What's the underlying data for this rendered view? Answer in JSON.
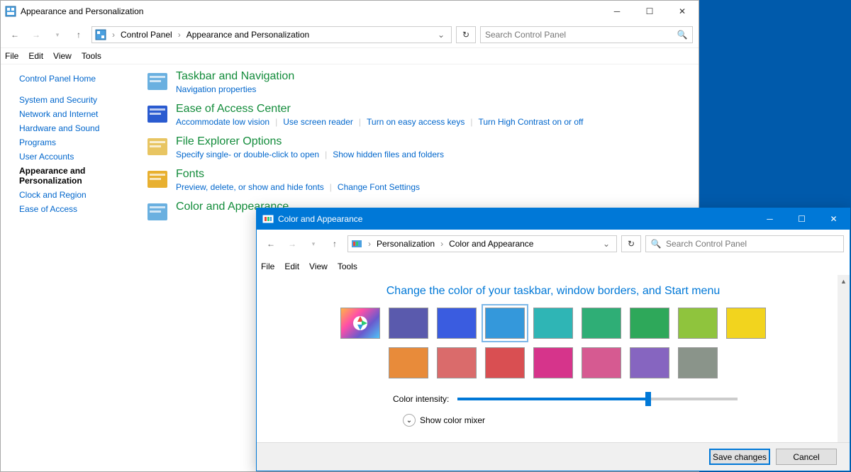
{
  "win1": {
    "title": "Appearance and Personalization",
    "breadcrumb": [
      "Control Panel",
      "Appearance and Personalization"
    ],
    "search_placeholder": "Search Control Panel",
    "menu": [
      "File",
      "Edit",
      "View",
      "Tools"
    ],
    "sidebar": {
      "home": "Control Panel Home",
      "items": [
        "System and Security",
        "Network and Internet",
        "Hardware and Sound",
        "Programs",
        "User Accounts",
        "Appearance and Personalization",
        "Clock and Region",
        "Ease of Access"
      ],
      "current_index": 5
    },
    "categories": [
      {
        "title": "Taskbar and Navigation",
        "links": [
          "Navigation properties"
        ]
      },
      {
        "title": "Ease of Access Center",
        "links": [
          "Accommodate low vision",
          "Use screen reader",
          "Turn on easy access keys",
          "Turn High Contrast on or off"
        ]
      },
      {
        "title": "File Explorer Options",
        "links": [
          "Specify single- or double-click to open",
          "Show hidden files and folders"
        ]
      },
      {
        "title": "Fonts",
        "links": [
          "Preview, delete, or show and hide fonts",
          "Change Font Settings"
        ]
      },
      {
        "title": "Color and Appearance",
        "links": []
      }
    ]
  },
  "win2": {
    "title": "Color and Appearance",
    "breadcrumb": [
      "Personalization",
      "Color and Appearance"
    ],
    "search_placeholder": "Search Control Panel",
    "menu": [
      "File",
      "Edit",
      "View",
      "Tools"
    ],
    "heading": "Change the color of your taskbar, window borders, and Start menu",
    "colors": [
      {
        "name": "Automatic",
        "hex": "auto"
      },
      {
        "name": "Indigo",
        "hex": "#5a5aad"
      },
      {
        "name": "Blue",
        "hex": "#3a5ce0"
      },
      {
        "name": "Sky",
        "hex": "#3498db",
        "selected": true
      },
      {
        "name": "Teal",
        "hex": "#2fb5b5"
      },
      {
        "name": "Green",
        "hex": "#2fae76"
      },
      {
        "name": "Emerald",
        "hex": "#2ea85a"
      },
      {
        "name": "Lime",
        "hex": "#8fc43d"
      },
      {
        "name": "Yellow",
        "hex": "#f2d41e"
      },
      {
        "name": "Orange",
        "hex": "#e88b3a"
      },
      {
        "name": "Salmon",
        "hex": "#da6b6b"
      },
      {
        "name": "Red",
        "hex": "#d94f52"
      },
      {
        "name": "Magenta",
        "hex": "#d6348b"
      },
      {
        "name": "Pink",
        "hex": "#d65a91"
      },
      {
        "name": "Purple",
        "hex": "#8665c0"
      },
      {
        "name": "Gray",
        "hex": "#8a948a"
      }
    ],
    "intensity_label": "Color intensity:",
    "intensity_value": 68,
    "mixer_label": "Show color mixer",
    "buttons": {
      "save": "Save changes",
      "cancel": "Cancel"
    }
  }
}
